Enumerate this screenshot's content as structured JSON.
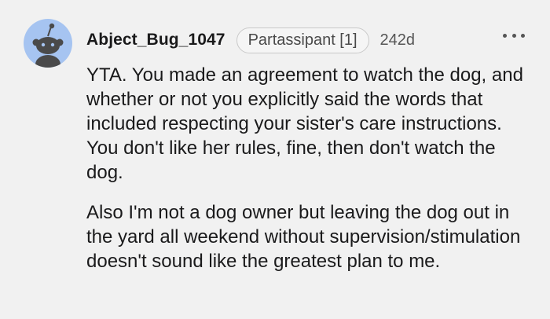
{
  "comment": {
    "username": "Abject_Bug_1047",
    "flair": "Partassipant [1]",
    "age": "242d",
    "more_icon": "ellipsis-icon",
    "avatar_icon": "reddit-snoo-avatar",
    "paragraphs": [
      "YTA. You made an agreement to watch the dog, and whether or not you explicitly said the words that included respecting your sister's care instructions. You don't like her rules, fine, then don't watch the dog.",
      "Also I'm not a dog owner but leaving the dog out in the yard all weekend without supervision/stimulation doesn't sound like the greatest plan to me."
    ]
  },
  "colors": {
    "background": "#f1f1f1",
    "avatar_bg": "#a6c4f1",
    "text": "#1a1a1b"
  }
}
